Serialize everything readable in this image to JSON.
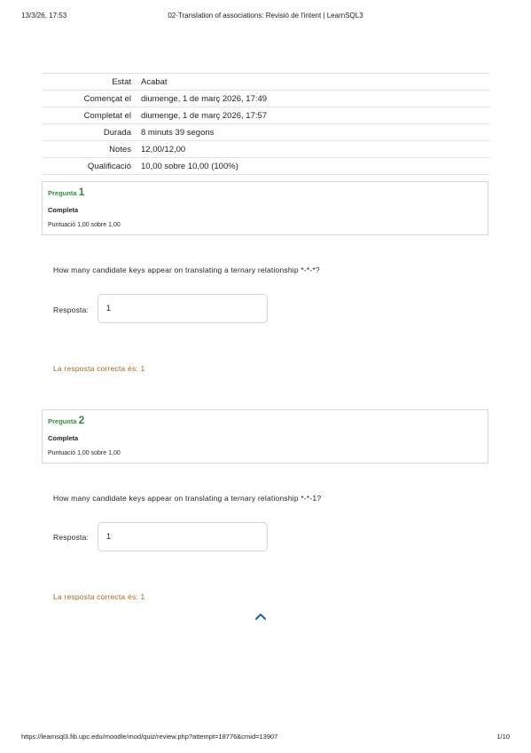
{
  "print_header": {
    "date": "13/3/26, 17:53",
    "title": "02-Translation of associations: Revisió de l'intent | LearnSQL3"
  },
  "summary": [
    {
      "label": "Estat",
      "value": "Acabat"
    },
    {
      "label": "Començat el",
      "value": "diumenge, 1 de març 2026, 17:49"
    },
    {
      "label": "Completat el",
      "value": "diumenge, 1 de març 2026, 17:57"
    },
    {
      "label": "Durada",
      "value": "8 minuts 39 segons"
    },
    {
      "label": "Notes",
      "value": "12,00/12,00"
    },
    {
      "label": "Qualificació",
      "value": "10,00 sobre 10,00 (100%)"
    }
  ],
  "questions": [
    {
      "prefix": "Pregunta",
      "number": "1",
      "state": "Completa",
      "grade": "Puntuació 1,00 sobre 1,00",
      "text": "How many candidate keys appear on translating a ternary relationship *-*-*?",
      "answer_label": "Resposta:",
      "answer_value": "1",
      "right_answer": "La resposta correcta és: 1"
    },
    {
      "prefix": "Pregunta",
      "number": "2",
      "state": "Completa",
      "grade": "Puntuació 1,00 sobre 1,00",
      "text": "How many candidate keys appear on translating a ternary relationship *-*-1?",
      "answer_label": "Resposta:",
      "answer_value": "1",
      "right_answer": "La resposta correcta és: 1"
    }
  ],
  "icons": {
    "back_to_top": "chevron-up-icon"
  },
  "colors": {
    "question_number": "#3a8a3a",
    "right_answer": "#a46a1a",
    "chevron": "#1f5fa8"
  },
  "print_footer": {
    "url": "https://learnsql3.fib.upc.edu/moodle/mod/quiz/review.php?attempt=18776&cmid=13907",
    "page": "1/10"
  }
}
